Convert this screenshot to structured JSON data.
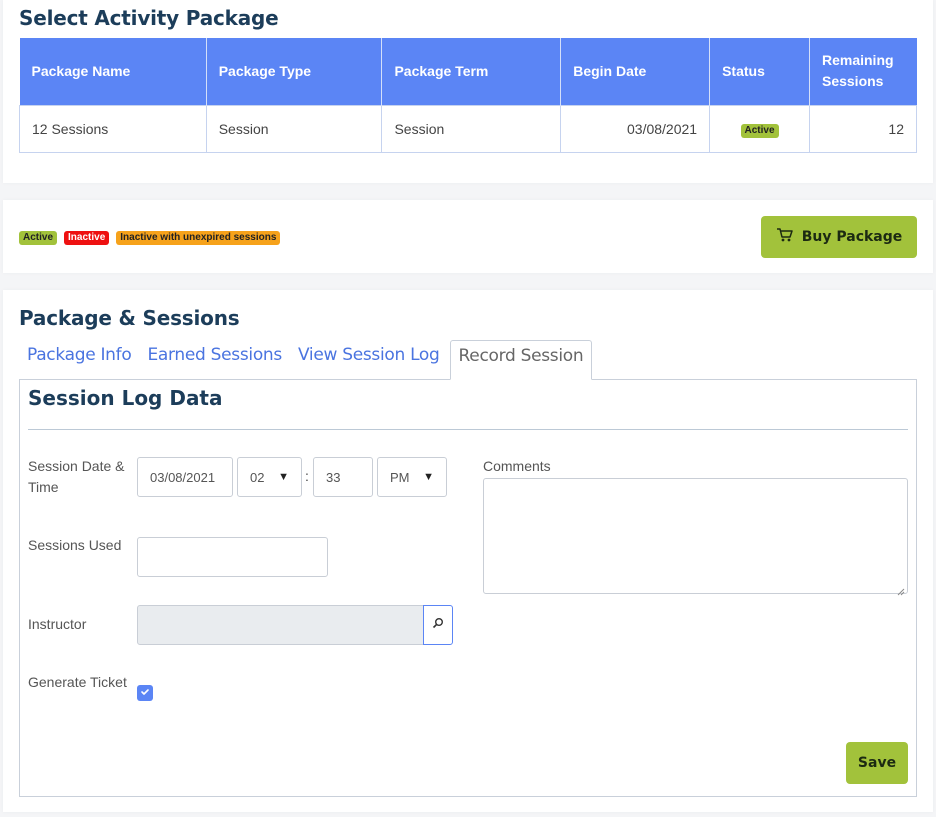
{
  "select_package": {
    "title": "Select Activity Package",
    "columns": [
      "Package Name",
      "Package Type",
      "Package Term",
      "Begin Date",
      "Status",
      "Remaining Sessions"
    ],
    "rows": [
      {
        "name": "12 Sessions",
        "type": "Session",
        "term": "Session",
        "begin_date": "03/08/2021",
        "status": "Active",
        "remaining": "12"
      }
    ]
  },
  "legend": {
    "active": "Active",
    "inactive": "Inactive",
    "unexpired": "Inactive with unexpired sessions"
  },
  "buy_button": {
    "label": "Buy Package",
    "icon": "cart-icon"
  },
  "package_sessions": {
    "title": "Package & Sessions",
    "tabs": [
      "Package Info",
      "Earned Sessions",
      "View Session Log",
      "Record Session"
    ],
    "active_tab": "Record Session"
  },
  "session_form": {
    "title": "Session Log Data",
    "date_label": "Session Date & Time",
    "date_value": "03/08/2021",
    "hour_value": "02",
    "minute_value": "33",
    "ampm_value": "PM",
    "time_separator": ":",
    "sessions_used_label": "Sessions Used",
    "sessions_used_value": "",
    "instructor_label": "Instructor",
    "instructor_value": "",
    "generate_ticket_label": "Generate Ticket",
    "generate_ticket_checked": true,
    "comments_label": "Comments",
    "comments_value": "",
    "save_label": "Save"
  },
  "colors": {
    "header_blue": "#5b85f5",
    "title_navy": "#1c3d5a",
    "accent_green": "#a2c23b",
    "badge_red": "#ee1111",
    "badge_orange": "#f6a21b",
    "link_blue": "#4a74e0"
  }
}
